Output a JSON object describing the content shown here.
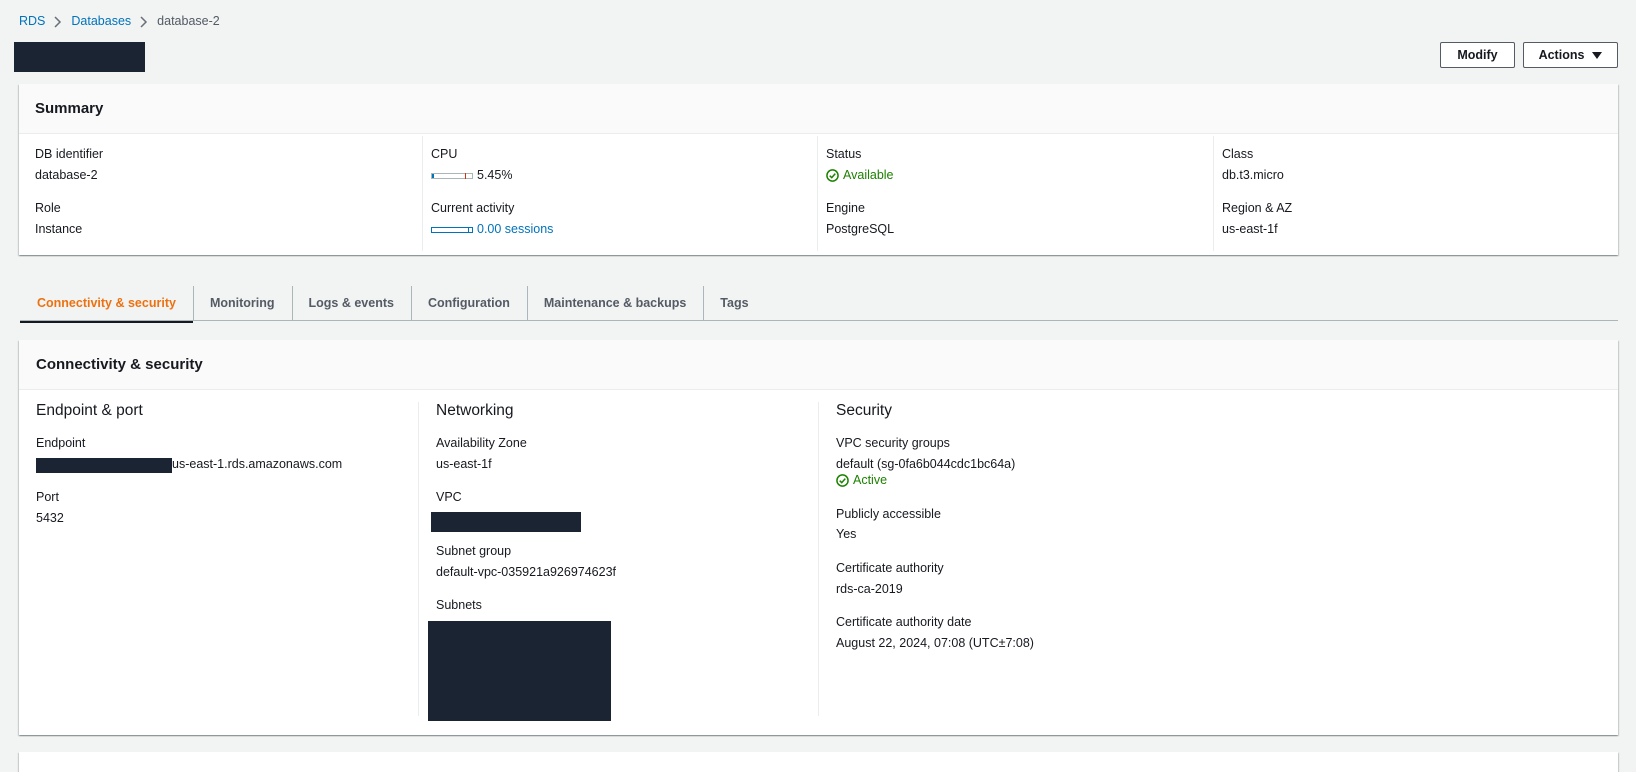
{
  "breadcrumb": {
    "items": [
      "RDS",
      "Databases"
    ],
    "current": "database-2"
  },
  "header": {
    "modify_label": "Modify",
    "actions_label": "Actions"
  },
  "summary": {
    "title": "Summary",
    "db_identifier_label": "DB identifier",
    "db_identifier": "database-2",
    "role_label": "Role",
    "role": "Instance",
    "cpu_label": "CPU",
    "cpu_value": "5.45%",
    "cpu_fraction": 0.0545,
    "activity_label": "Current activity",
    "activity_value": "0.00 sessions",
    "status_label": "Status",
    "status": "Available",
    "engine_label": "Engine",
    "engine": "PostgreSQL",
    "class_label": "Class",
    "class": "db.t3.micro",
    "region_label": "Region & AZ",
    "region": "us-east-1f"
  },
  "tabs": [
    {
      "label": "Connectivity & security",
      "active": true
    },
    {
      "label": "Monitoring",
      "active": false
    },
    {
      "label": "Logs & events",
      "active": false
    },
    {
      "label": "Configuration",
      "active": false
    },
    {
      "label": "Maintenance & backups",
      "active": false
    },
    {
      "label": "Tags",
      "active": false
    }
  ],
  "connectivity": {
    "title": "Connectivity & security",
    "endpoint_section": {
      "heading": "Endpoint & port",
      "endpoint_label": "Endpoint",
      "endpoint_suffix": "us-east-1.rds.amazonaws.com",
      "port_label": "Port",
      "port": "5432"
    },
    "networking": {
      "heading": "Networking",
      "az_label": "Availability Zone",
      "az": "us-east-1f",
      "vpc_label": "VPC",
      "subnet_group_label": "Subnet group",
      "subnet_group": "default-vpc-035921a926974623f",
      "subnets_label": "Subnets"
    },
    "security": {
      "heading": "Security",
      "vpc_sg_label": "VPC security groups",
      "vpc_sg": "default (sg-0fa6b044cdc1bc64a)",
      "vpc_sg_status": "Active",
      "public_label": "Publicly accessible",
      "public": "Yes",
      "ca_label": "Certificate authority",
      "ca": "rds-ca-2019",
      "ca_date_label": "Certificate authority date",
      "ca_date": "August 22, 2024, 07:08 (UTC±7:08)"
    }
  },
  "colors": {
    "link": "#0073bb",
    "success": "#1d8102",
    "active_tab": "#ec7211",
    "redaction": "#1b2433"
  }
}
